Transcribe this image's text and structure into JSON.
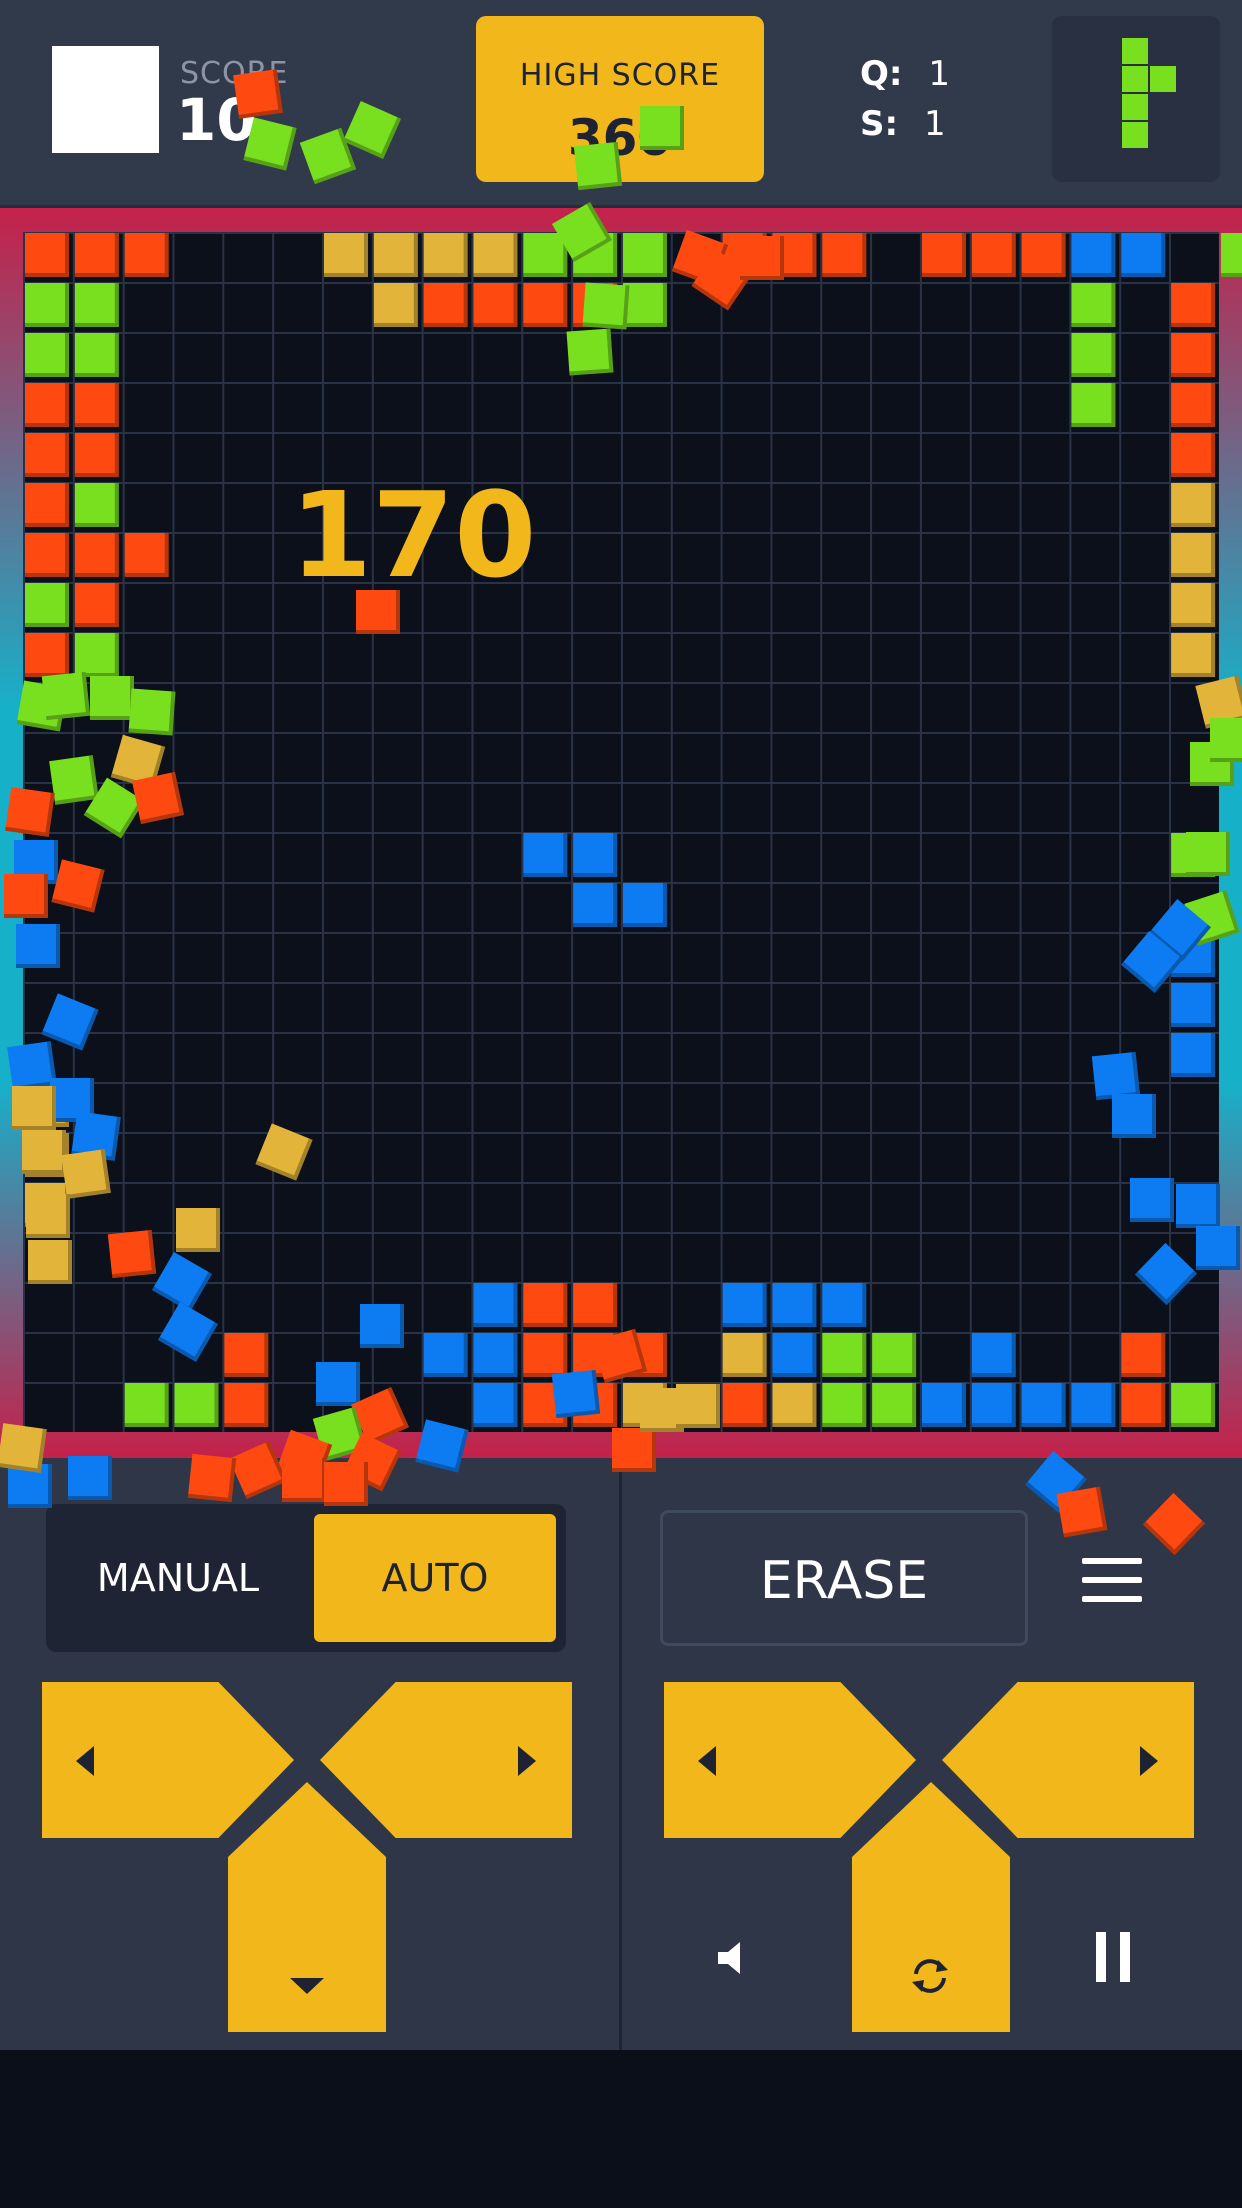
{
  "header": {
    "score_label": "SCORE",
    "score_value": "10",
    "high_score_label": "HIGH SCORE",
    "high_score_value": "360",
    "q_label": "Q:",
    "q_value": "1",
    "s_label": "S:",
    "s_value": "1"
  },
  "board": {
    "points_popup": "170"
  },
  "controls": {
    "manual_label": "MANUAL",
    "auto_label": "AUTO",
    "selected_mode": "AUTO",
    "erase_label": "ERASE"
  },
  "colors": {
    "accent": "#f2b71a",
    "green": "#78e01e",
    "red": "#fe4a10",
    "blue": "#0d7cf2",
    "gold": "#e2b53a",
    "background": "#2e3647"
  },
  "icons": [
    "left-arrow-icon",
    "right-arrow-icon",
    "down-arrow-icon",
    "rotate-icon",
    "sound-icon",
    "pause-icon",
    "menu-icon"
  ]
}
